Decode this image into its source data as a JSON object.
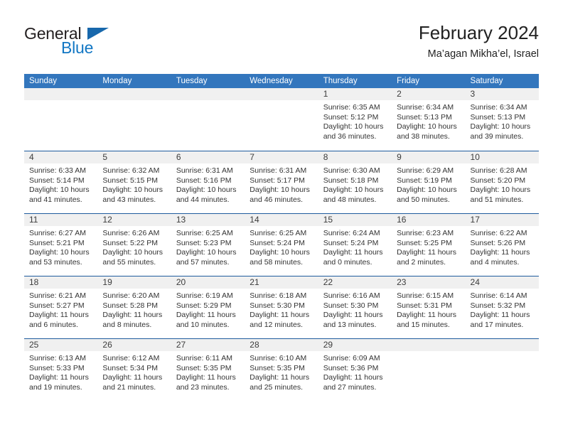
{
  "brand": {
    "name_part1": "General",
    "name_part2": "Blue",
    "logo_icon": "blue-triangle-icon",
    "colors": {
      "dark_text": "#231f20",
      "blue_text": "#1277c4",
      "triangle": "#1868ac"
    }
  },
  "header": {
    "title": "February 2024",
    "subtitle": "Ma’agan Mikha’el, Israel"
  },
  "colors": {
    "header_blue": "#3376bd",
    "separator_blue": "#1f5c9e",
    "daynum_band": "#f0f0f0",
    "body_text": "#333333"
  },
  "weekdays": [
    "Sunday",
    "Monday",
    "Tuesday",
    "Wednesday",
    "Thursday",
    "Friday",
    "Saturday"
  ],
  "weeks": [
    [
      {
        "day": "",
        "sunrise": "",
        "sunset": "",
        "daylight_line1": "",
        "daylight_line2": ""
      },
      {
        "day": "",
        "sunrise": "",
        "sunset": "",
        "daylight_line1": "",
        "daylight_line2": ""
      },
      {
        "day": "",
        "sunrise": "",
        "sunset": "",
        "daylight_line1": "",
        "daylight_line2": ""
      },
      {
        "day": "",
        "sunrise": "",
        "sunset": "",
        "daylight_line1": "",
        "daylight_line2": ""
      },
      {
        "day": "1",
        "sunrise": "Sunrise: 6:35 AM",
        "sunset": "Sunset: 5:12 PM",
        "daylight_line1": "Daylight: 10 hours",
        "daylight_line2": "and 36 minutes."
      },
      {
        "day": "2",
        "sunrise": "Sunrise: 6:34 AM",
        "sunset": "Sunset: 5:13 PM",
        "daylight_line1": "Daylight: 10 hours",
        "daylight_line2": "and 38 minutes."
      },
      {
        "day": "3",
        "sunrise": "Sunrise: 6:34 AM",
        "sunset": "Sunset: 5:13 PM",
        "daylight_line1": "Daylight: 10 hours",
        "daylight_line2": "and 39 minutes."
      }
    ],
    [
      {
        "day": "4",
        "sunrise": "Sunrise: 6:33 AM",
        "sunset": "Sunset: 5:14 PM",
        "daylight_line1": "Daylight: 10 hours",
        "daylight_line2": "and 41 minutes."
      },
      {
        "day": "5",
        "sunrise": "Sunrise: 6:32 AM",
        "sunset": "Sunset: 5:15 PM",
        "daylight_line1": "Daylight: 10 hours",
        "daylight_line2": "and 43 minutes."
      },
      {
        "day": "6",
        "sunrise": "Sunrise: 6:31 AM",
        "sunset": "Sunset: 5:16 PM",
        "daylight_line1": "Daylight: 10 hours",
        "daylight_line2": "and 44 minutes."
      },
      {
        "day": "7",
        "sunrise": "Sunrise: 6:31 AM",
        "sunset": "Sunset: 5:17 PM",
        "daylight_line1": "Daylight: 10 hours",
        "daylight_line2": "and 46 minutes."
      },
      {
        "day": "8",
        "sunrise": "Sunrise: 6:30 AM",
        "sunset": "Sunset: 5:18 PM",
        "daylight_line1": "Daylight: 10 hours",
        "daylight_line2": "and 48 minutes."
      },
      {
        "day": "9",
        "sunrise": "Sunrise: 6:29 AM",
        "sunset": "Sunset: 5:19 PM",
        "daylight_line1": "Daylight: 10 hours",
        "daylight_line2": "and 50 minutes."
      },
      {
        "day": "10",
        "sunrise": "Sunrise: 6:28 AM",
        "sunset": "Sunset: 5:20 PM",
        "daylight_line1": "Daylight: 10 hours",
        "daylight_line2": "and 51 minutes."
      }
    ],
    [
      {
        "day": "11",
        "sunrise": "Sunrise: 6:27 AM",
        "sunset": "Sunset: 5:21 PM",
        "daylight_line1": "Daylight: 10 hours",
        "daylight_line2": "and 53 minutes."
      },
      {
        "day": "12",
        "sunrise": "Sunrise: 6:26 AM",
        "sunset": "Sunset: 5:22 PM",
        "daylight_line1": "Daylight: 10 hours",
        "daylight_line2": "and 55 minutes."
      },
      {
        "day": "13",
        "sunrise": "Sunrise: 6:25 AM",
        "sunset": "Sunset: 5:23 PM",
        "daylight_line1": "Daylight: 10 hours",
        "daylight_line2": "and 57 minutes."
      },
      {
        "day": "14",
        "sunrise": "Sunrise: 6:25 AM",
        "sunset": "Sunset: 5:24 PM",
        "daylight_line1": "Daylight: 10 hours",
        "daylight_line2": "and 58 minutes."
      },
      {
        "day": "15",
        "sunrise": "Sunrise: 6:24 AM",
        "sunset": "Sunset: 5:24 PM",
        "daylight_line1": "Daylight: 11 hours",
        "daylight_line2": "and 0 minutes."
      },
      {
        "day": "16",
        "sunrise": "Sunrise: 6:23 AM",
        "sunset": "Sunset: 5:25 PM",
        "daylight_line1": "Daylight: 11 hours",
        "daylight_line2": "and 2 minutes."
      },
      {
        "day": "17",
        "sunrise": "Sunrise: 6:22 AM",
        "sunset": "Sunset: 5:26 PM",
        "daylight_line1": "Daylight: 11 hours",
        "daylight_line2": "and 4 minutes."
      }
    ],
    [
      {
        "day": "18",
        "sunrise": "Sunrise: 6:21 AM",
        "sunset": "Sunset: 5:27 PM",
        "daylight_line1": "Daylight: 11 hours",
        "daylight_line2": "and 6 minutes."
      },
      {
        "day": "19",
        "sunrise": "Sunrise: 6:20 AM",
        "sunset": "Sunset: 5:28 PM",
        "daylight_line1": "Daylight: 11 hours",
        "daylight_line2": "and 8 minutes."
      },
      {
        "day": "20",
        "sunrise": "Sunrise: 6:19 AM",
        "sunset": "Sunset: 5:29 PM",
        "daylight_line1": "Daylight: 11 hours",
        "daylight_line2": "and 10 minutes."
      },
      {
        "day": "21",
        "sunrise": "Sunrise: 6:18 AM",
        "sunset": "Sunset: 5:30 PM",
        "daylight_line1": "Daylight: 11 hours",
        "daylight_line2": "and 12 minutes."
      },
      {
        "day": "22",
        "sunrise": "Sunrise: 6:16 AM",
        "sunset": "Sunset: 5:30 PM",
        "daylight_line1": "Daylight: 11 hours",
        "daylight_line2": "and 13 minutes."
      },
      {
        "day": "23",
        "sunrise": "Sunrise: 6:15 AM",
        "sunset": "Sunset: 5:31 PM",
        "daylight_line1": "Daylight: 11 hours",
        "daylight_line2": "and 15 minutes."
      },
      {
        "day": "24",
        "sunrise": "Sunrise: 6:14 AM",
        "sunset": "Sunset: 5:32 PM",
        "daylight_line1": "Daylight: 11 hours",
        "daylight_line2": "and 17 minutes."
      }
    ],
    [
      {
        "day": "25",
        "sunrise": "Sunrise: 6:13 AM",
        "sunset": "Sunset: 5:33 PM",
        "daylight_line1": "Daylight: 11 hours",
        "daylight_line2": "and 19 minutes."
      },
      {
        "day": "26",
        "sunrise": "Sunrise: 6:12 AM",
        "sunset": "Sunset: 5:34 PM",
        "daylight_line1": "Daylight: 11 hours",
        "daylight_line2": "and 21 minutes."
      },
      {
        "day": "27",
        "sunrise": "Sunrise: 6:11 AM",
        "sunset": "Sunset: 5:35 PM",
        "daylight_line1": "Daylight: 11 hours",
        "daylight_line2": "and 23 minutes."
      },
      {
        "day": "28",
        "sunrise": "Sunrise: 6:10 AM",
        "sunset": "Sunset: 5:35 PM",
        "daylight_line1": "Daylight: 11 hours",
        "daylight_line2": "and 25 minutes."
      },
      {
        "day": "29",
        "sunrise": "Sunrise: 6:09 AM",
        "sunset": "Sunset: 5:36 PM",
        "daylight_line1": "Daylight: 11 hours",
        "daylight_line2": "and 27 minutes."
      },
      {
        "day": "",
        "sunrise": "",
        "sunset": "",
        "daylight_line1": "",
        "daylight_line2": ""
      },
      {
        "day": "",
        "sunrise": "",
        "sunset": "",
        "daylight_line1": "",
        "daylight_line2": ""
      }
    ]
  ]
}
